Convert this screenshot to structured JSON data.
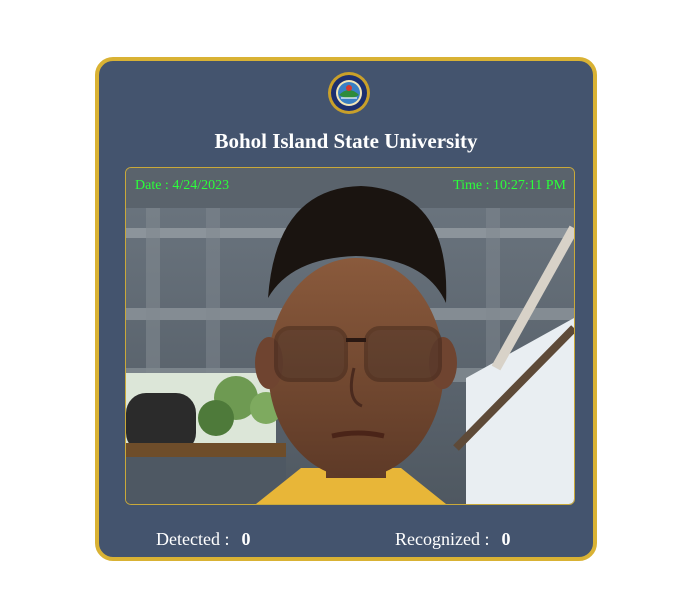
{
  "header": {
    "logo_icon": "university-seal-icon",
    "title": "Bohol Island State University"
  },
  "camera": {
    "date_label": "Date : 4/24/2023",
    "time_label": "Time : 10:27:11 PM",
    "overlay_color": "#2bff3a"
  },
  "stats": {
    "detected_label": "Detected :",
    "detected_value": "0",
    "recognized_label": "Recognized :",
    "recognized_value": "0"
  },
  "colors": {
    "panel": "#44546e",
    "border": "#d9b234"
  }
}
